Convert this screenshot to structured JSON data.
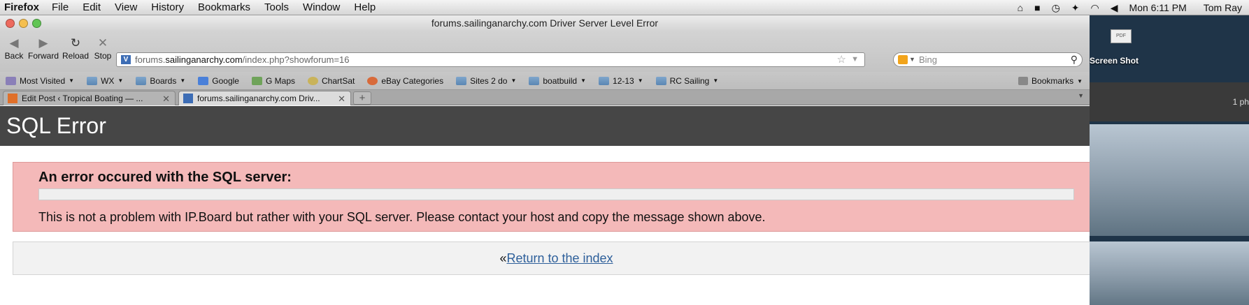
{
  "menubar": {
    "app": "Firefox",
    "items": [
      "File",
      "Edit",
      "View",
      "History",
      "Bookmarks",
      "Tools",
      "Window",
      "Help"
    ],
    "clock": "Mon 6:11 PM",
    "user": "Tom Ray"
  },
  "window": {
    "title": "forums.sailinganarchy.com Driver Server Level Error"
  },
  "navbar": {
    "back": "Back",
    "forward": "Forward",
    "reload": "Reload",
    "stop": "Stop",
    "url_prefix": "forums.",
    "url_domain": "sailinganarchy.com",
    "url_path": "/index.php?showforum=16",
    "search_placeholder": "Bing"
  },
  "bookmarks": {
    "items": [
      {
        "label": "Most Visited",
        "dropdown": true
      },
      {
        "label": "WX",
        "dropdown": true
      },
      {
        "label": "Boards",
        "dropdown": true
      },
      {
        "label": "Google",
        "dropdown": false
      },
      {
        "label": "G Maps",
        "dropdown": false
      },
      {
        "label": "ChartSat",
        "dropdown": false
      },
      {
        "label": "eBay Categories",
        "dropdown": false
      },
      {
        "label": "Sites 2 do",
        "dropdown": true
      },
      {
        "label": "boatbuild",
        "dropdown": true
      },
      {
        "label": "12-13",
        "dropdown": true
      },
      {
        "label": "RC Sailing",
        "dropdown": true
      }
    ],
    "right": "Bookmarks"
  },
  "tabs": [
    {
      "label": "Edit Post ‹ Tropical Boating — ..."
    },
    {
      "label": "forums.sailinganarchy.com Driv..."
    }
  ],
  "page": {
    "header_title": "SQL Error",
    "error_heading": "An error occured with the SQL server:",
    "error_desc": "This is not a problem with IP.Board but rather with your SQL server. Please contact your host and copy the message shown above.",
    "return_prefix": "«",
    "return_link": "Return to the index"
  },
  "desktop": {
    "file_label": "Screen Shot",
    "file_badge": "PDF",
    "photos_count": "1 ph"
  }
}
